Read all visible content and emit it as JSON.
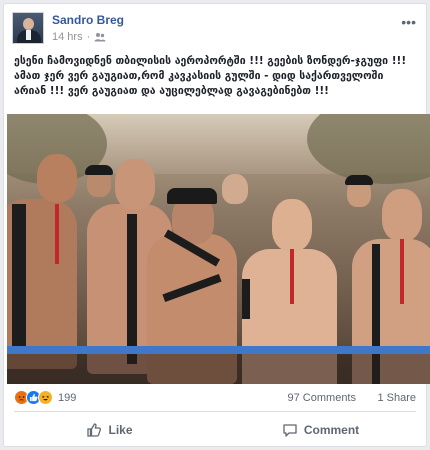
{
  "post": {
    "author": "Sandro Breg",
    "timestamp": "14 hrs",
    "audience_icon": "friends-icon",
    "more_icon": "ellipsis-icon",
    "text": "ესენი ჩამოვიდნენ თბილისის აეროპორტში !!! გეების ზონდერ-ჯგუფი !!! ამათ ჯერ ვერ გაუგიათ,რომ კავკასიის გულში - დიდ საქართველოში არიან !!! ვერ გაუგიათ და აუცილებლად გავაგებინებთ !!!"
  },
  "stats": {
    "reaction_icons": [
      "angry-react-icon",
      "like-react-icon",
      "haha-react-icon"
    ],
    "reaction_count": "199",
    "comments": "97 Comments",
    "shares": "1 Share"
  },
  "actions": {
    "like_label": "Like",
    "comment_label": "Comment"
  },
  "colors": {
    "author_link": "#365899",
    "meta_gray": "#90949c",
    "railing_blue": "#3f78c9"
  }
}
